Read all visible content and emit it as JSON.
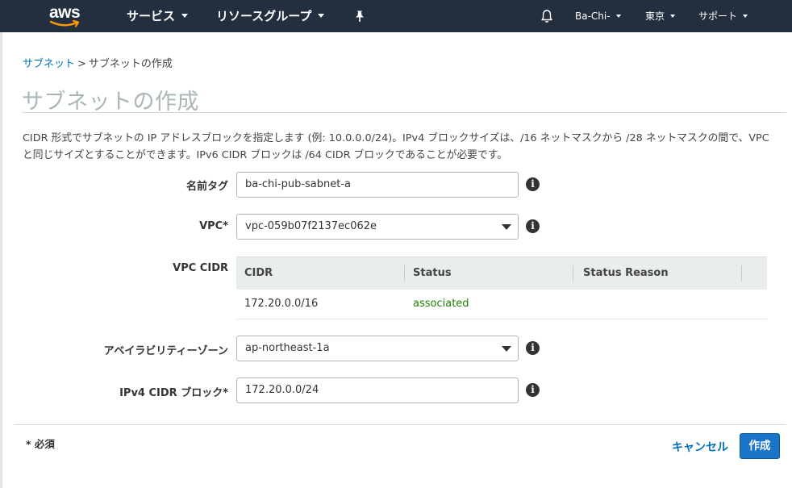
{
  "topnav": {
    "logo_text": "aws",
    "services_label": "サービス",
    "resource_groups_label": "リソースグループ",
    "pin_icon": "pin-icon",
    "bell_icon": "bell-icon",
    "account_label": "Ba-Chi-",
    "region_label": "東京",
    "support_label": "サポート"
  },
  "breadcrumb": {
    "parent": "サブネット",
    "separator": ">",
    "current": "サブネットの作成"
  },
  "page": {
    "title": "サブネットの作成",
    "description": "CIDR 形式でサブネットの IP アドレスブロックを指定します (例: 10.0.0.0/24)。IPv4 ブロックサイズは、/16 ネットマスクから /28 ネットマスクの間で、VPC と同じサイズとすることができます。IPv6 CIDR ブロックは /64 CIDR ブロックであることが必要です。"
  },
  "form": {
    "name_tag": {
      "label": "名前タグ",
      "value": "ba-chi-pub-sabnet-a"
    },
    "vpc": {
      "label": "VPC*",
      "value": "vpc-059b07f2137ec062e"
    },
    "vpc_cidr": {
      "label": "VPC CIDR",
      "columns": [
        "CIDR",
        "Status",
        "Status Reason"
      ],
      "rows": [
        {
          "cidr": "172.20.0.0/16",
          "status": "associated",
          "reason": ""
        }
      ]
    },
    "availability_zone": {
      "label": "アベイラビリティーゾーン",
      "value": "ap-northeast-1a"
    },
    "ipv4_cidr": {
      "label": "IPv4 CIDR ブロック*",
      "value": "172.20.0.0/24"
    },
    "info_glyph": "i"
  },
  "footer": {
    "required_note": "* 必須",
    "cancel_label": "キャンセル",
    "create_label": "作成"
  },
  "colors": {
    "nav_bg": "#232f3e",
    "link": "#0073bb",
    "primary_button": "#1a75c9",
    "status_green": "#1d8102",
    "title_gray": "#aab7b8",
    "logo_smile": "#ff9900"
  }
}
